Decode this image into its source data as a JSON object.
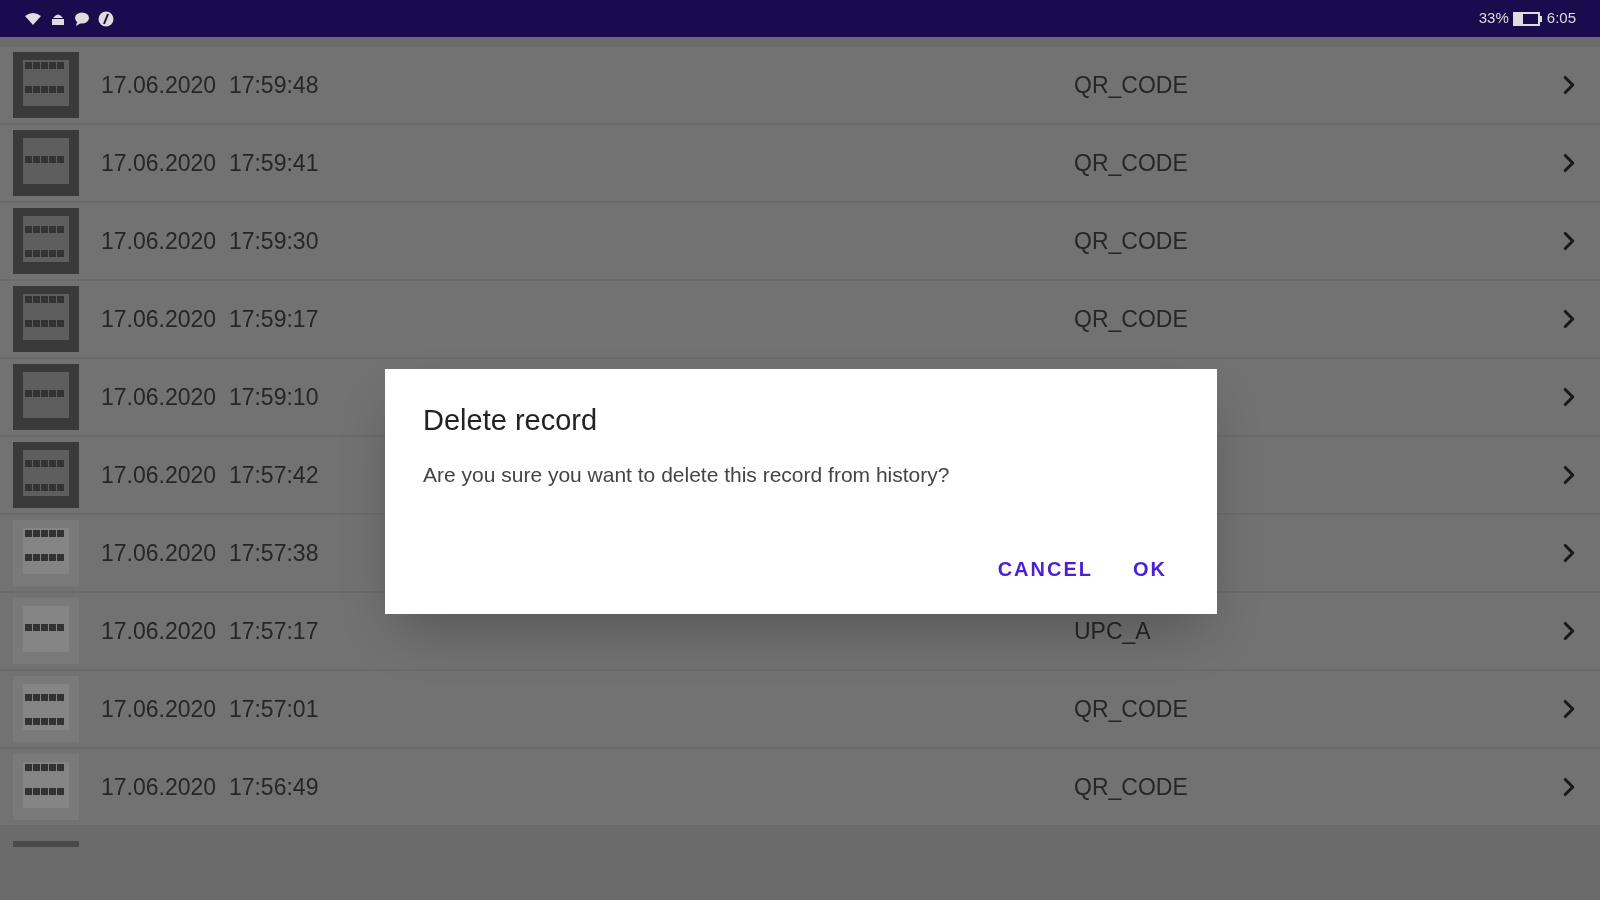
{
  "status_bar": {
    "battery": "33%",
    "time": "6:05"
  },
  "records": [
    {
      "timestamp": "17.06.2020  17:59:48",
      "type": "QR_CODE"
    },
    {
      "timestamp": "17.06.2020  17:59:41",
      "type": "QR_CODE"
    },
    {
      "timestamp": "17.06.2020  17:59:30",
      "type": "QR_CODE"
    },
    {
      "timestamp": "17.06.2020  17:59:17",
      "type": "QR_CODE"
    },
    {
      "timestamp": "17.06.2020  17:59:10"
    },
    {
      "timestamp": "17.06.2020  17:57:42"
    },
    {
      "timestamp": "17.06.2020  17:57:38"
    },
    {
      "timestamp": "17.06.2020  17:57:17",
      "type": "UPC_A"
    },
    {
      "timestamp": "17.06.2020  17:57:01",
      "type": "QR_CODE"
    },
    {
      "timestamp": "17.06.2020  17:56:49",
      "type": "QR_CODE"
    }
  ],
  "dialog": {
    "title": "Delete record",
    "message": "Are you sure you want to delete this record from history?",
    "buttons": [
      "CANCEL",
      "OK"
    ]
  }
}
